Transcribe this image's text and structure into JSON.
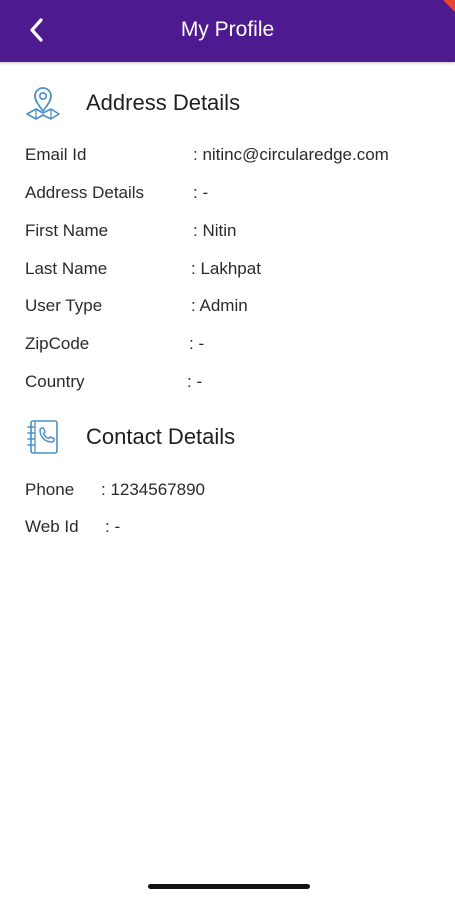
{
  "header": {
    "title": "My Profile",
    "back_icon": "chevron-left-icon",
    "background_color": "#4e1a8f"
  },
  "address_section": {
    "title": "Address Details",
    "icon": "location-map-icon",
    "fields": [
      {
        "label": "Email Id",
        "value": ": nitinc@circularedge.com"
      },
      {
        "label": "Address Details",
        "value": ": -"
      },
      {
        "label": "First Name",
        "value": ": Nitin"
      },
      {
        "label": "Last Name",
        "value": ": Lakhpat"
      },
      {
        "label": "User Type",
        "value": ": Admin"
      },
      {
        "label": "ZipCode",
        "value": ": -"
      },
      {
        "label": "Country",
        "value": ": -"
      }
    ]
  },
  "contact_section": {
    "title": "Contact Details",
    "icon": "phone-book-icon",
    "fields": [
      {
        "label": "Phone",
        "value": ": 1234567890"
      },
      {
        "label": "Web Id",
        "value": ": -"
      }
    ]
  },
  "colors": {
    "accent": "#4e1a8f",
    "icon_blue": "#4a90c8"
  }
}
